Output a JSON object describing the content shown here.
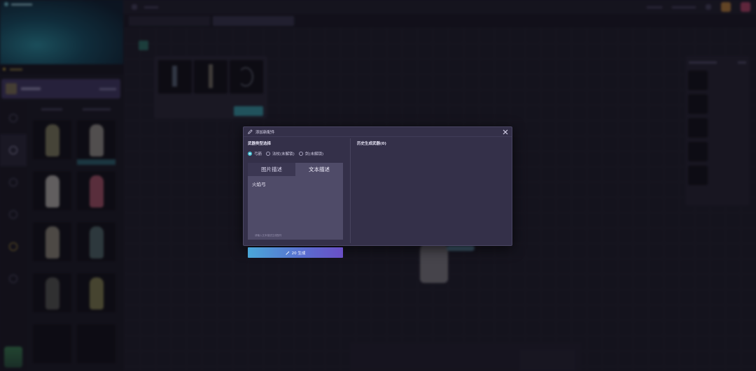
{
  "dialog": {
    "title": "添加新配件",
    "weapon_type_title": "武器类型选择",
    "weapon_types": [
      {
        "label": "弓箭",
        "checked": true
      },
      {
        "label": "法杖(未解锁)",
        "checked": false
      },
      {
        "label": "剑(未解锁)",
        "checked": false
      }
    ],
    "tabs": [
      {
        "label": "图片描述",
        "active": false
      },
      {
        "label": "文本描述",
        "active": true
      }
    ],
    "prompt_value": "火焰弓",
    "prompt_hint": "请输入文本描述生成配件",
    "generate_label": "20 生成",
    "history_title": "历史生成武器(0)"
  },
  "colors": {
    "accent": "#4cc0d2",
    "generate_gradient_start": "#4aa7d8",
    "generate_gradient_end": "#6a4fc6",
    "dialog_bg": "#343049"
  },
  "icons": [
    "edit-icon",
    "close-icon",
    "magic-wand-icon"
  ]
}
